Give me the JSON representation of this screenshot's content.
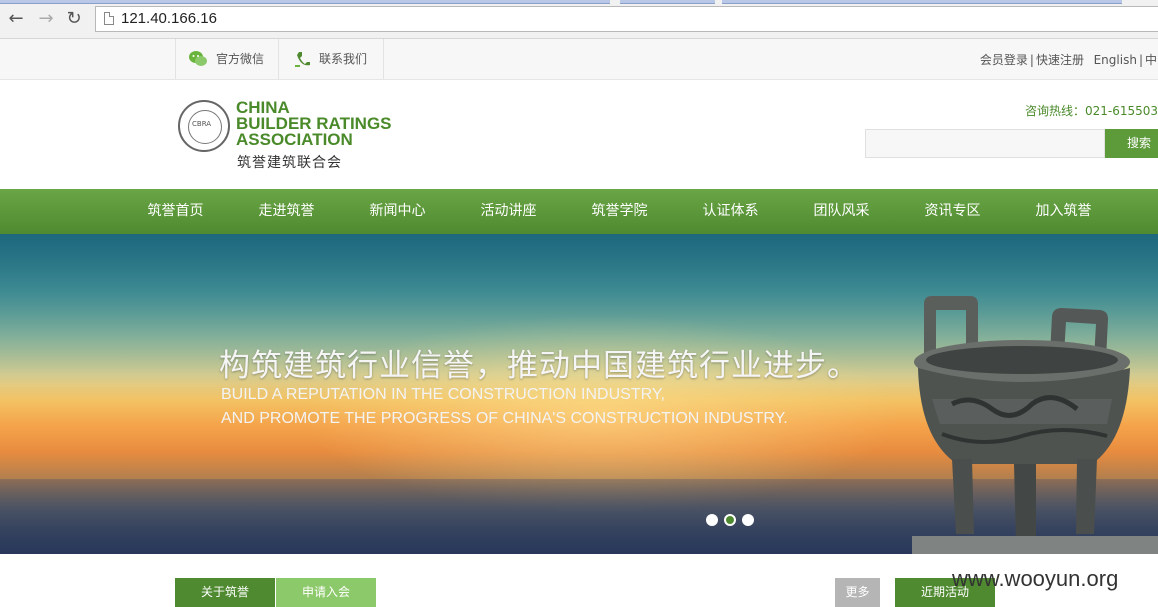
{
  "browser": {
    "url": "121.40.166.16",
    "back_icon": "arrow-left-icon",
    "forward_icon": "arrow-right-icon",
    "reload_icon": "reload-icon"
  },
  "topbar": {
    "wechat_label": "官方微信",
    "contact_label": "联系我们",
    "login": "会员登录",
    "sep1": "|",
    "register": "快速注册",
    "english": "English",
    "sep2": "|",
    "chinese": "中"
  },
  "header": {
    "logo_en_1": "CHINA",
    "logo_en_2": "BUILDER RATINGS",
    "logo_en_3": "ASSOCIATION",
    "logo_cn": "筑誉建筑联合会",
    "seal_text": "CBRA",
    "hotline": "咨询热线：021-615503",
    "search_button": "搜索"
  },
  "nav": {
    "items": [
      "筑誉首页",
      "走进筑誉",
      "新闻中心",
      "活动讲座",
      "筑誉学院",
      "认证体系",
      "团队风采",
      "资讯专区",
      "加入筑誉"
    ]
  },
  "banner": {
    "title": "构筑建筑行业信誉，推动中国建筑行业进步。",
    "subtitle_line1": "BUILD A REPUTATION IN THE CONSTRUCTION INDUSTRY,",
    "subtitle_line2": "AND PROMOTE THE PROGRESS OF CHINA'S CONSTRUCTION INDUSTRY.",
    "slide_count": 3,
    "active_slide": 2
  },
  "sections": {
    "about_tab": "关于筑誉",
    "apply_tab": "申请入会",
    "more_button": "更多",
    "events_tab": "近期活动"
  },
  "watermark": "www.wooyun.org",
  "colors": {
    "brand_green": "#5d9a3a",
    "nav_green": "#4f8a30",
    "light_green": "#8cc96a",
    "gray_button": "#b5b5b5"
  }
}
